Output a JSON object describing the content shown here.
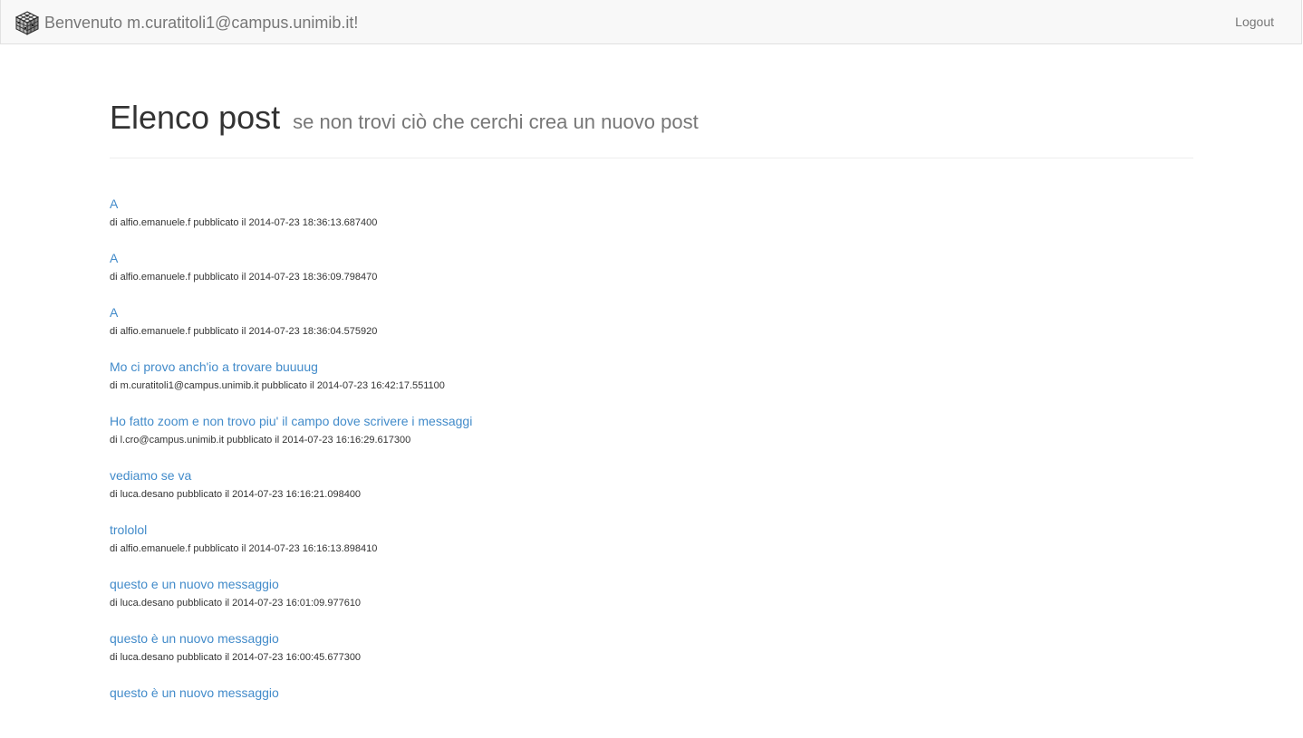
{
  "navbar": {
    "welcome": "Benvenuto m.curatitoli1@campus.unimib.it!",
    "logout_label": "Logout",
    "logo_icon": "rubiks-cube-icon"
  },
  "header": {
    "title": "Elenco post",
    "subtitle": "se non trovi ciò che cerchi crea un nuovo post"
  },
  "posts": [
    {
      "title": "A",
      "meta": "di alfio.emanuele.f pubblicato il 2014-07-23 18:36:13.687400"
    },
    {
      "title": "A",
      "meta": "di alfio.emanuele.f pubblicato il 2014-07-23 18:36:09.798470"
    },
    {
      "title": "A",
      "meta": "di alfio.emanuele.f pubblicato il 2014-07-23 18:36:04.575920"
    },
    {
      "title": "Mo ci provo anch'io a trovare buuuug",
      "meta": "di m.curatitoli1@campus.unimib.it pubblicato il 2014-07-23 16:42:17.551100"
    },
    {
      "title": "Ho fatto zoom e non trovo piu' il campo dove scrivere i messaggi",
      "meta": "di l.cro@campus.unimib.it pubblicato il 2014-07-23 16:16:29.617300"
    },
    {
      "title": "vediamo se va",
      "meta": "di luca.desano pubblicato il 2014-07-23 16:16:21.098400"
    },
    {
      "title": "trololol",
      "meta": "di alfio.emanuele.f pubblicato il 2014-07-23 16:16:13.898410"
    },
    {
      "title": "questo e un nuovo messaggio",
      "meta": "di luca.desano pubblicato il 2014-07-23 16:01:09.977610"
    },
    {
      "title": "questo è un nuovo messaggio",
      "meta": "di luca.desano pubblicato il 2014-07-23 16:00:45.677300"
    },
    {
      "title": "questo è un nuovo messaggio",
      "meta": ""
    }
  ]
}
